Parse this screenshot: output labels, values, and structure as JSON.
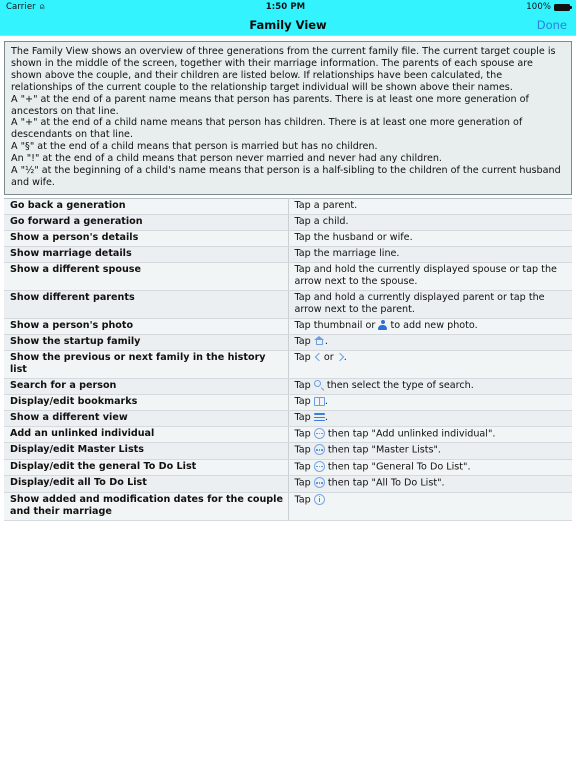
{
  "status_bar": {
    "carrier": "Carrier",
    "wifi_icon": "wifi-icon",
    "time": "1:50 PM",
    "battery_percent": "100%",
    "battery_icon": "battery-full-icon"
  },
  "nav_bar": {
    "title": "Family View",
    "done_label": "Done",
    "done_color": "#2a7fdc",
    "bar_color": "#33f3ff"
  },
  "info_box": {
    "paragraphs": [
      "The Family View shows an overview of three generations from the current family file. The current target couple is shown in the middle of the screen, together with their marriage information. The parents of each spouse are shown above the couple, and their children are listed below. If relationships have been calculated, the relationships of the current couple to the relationship target individual will be shown above their names.",
      "A \"+\" at the end of a parent name means that person has parents. There is at least one more generation of ancestors on that line.",
      "A \"+\" at the end of a child name means that person has children. There is at least one more generation of descendants on that line.",
      "A \"§\" at the end of a child means that person is married but has no children.",
      "An \"!\" at the end of a child means that person never married and never had any children.",
      "A \"½\" at the beginning of a child's name means that person is a half-sibling to the children of the current husband and wife."
    ]
  },
  "table": {
    "rows": [
      {
        "action": "Go back a generation",
        "howto_pre": "Tap a parent.",
        "icon": null,
        "howto_post": ""
      },
      {
        "action": "Go forward a generation",
        "howto_pre": "Tap a child.",
        "icon": null,
        "howto_post": ""
      },
      {
        "action": "Show a person's details",
        "howto_pre": "Tap the husband or wife.",
        "icon": null,
        "howto_post": ""
      },
      {
        "action": "Show marriage details",
        "howto_pre": "Tap the marriage line.",
        "icon": null,
        "howto_post": ""
      },
      {
        "action": "Show a different spouse",
        "howto_pre": "Tap and hold the currently displayed spouse or tap the arrow next to the spouse.",
        "icon": null,
        "howto_post": ""
      },
      {
        "action": "Show different parents",
        "howto_pre": "Tap and hold a currently displayed parent or tap the arrow next to the parent.",
        "icon": null,
        "howto_post": ""
      },
      {
        "action": "Show a person's photo",
        "howto_pre": "Tap thumbnail or",
        "icon": "person-icon",
        "howto_post": "to add new photo."
      },
      {
        "action": "Show the startup family",
        "howto_pre": "Tap",
        "icon": "home-icon",
        "howto_post": "."
      },
      {
        "action": "Show the previous or next family in the history list",
        "howto_pre": "Tap",
        "icon": "chevron-left-right-icon",
        "howto_post": ".",
        "icon_middle_text": "or"
      },
      {
        "action": "Search for a person",
        "howto_pre": "Tap",
        "icon": "search-icon",
        "howto_post": "then select the type of search."
      },
      {
        "action": "Display/edit bookmarks",
        "howto_pre": "Tap",
        "icon": "book-icon",
        "howto_post": "."
      },
      {
        "action": "Show a different view",
        "howto_pre": "Tap",
        "icon": "menu-icon",
        "howto_post": "."
      },
      {
        "action": "Add an unlinked individual",
        "howto_pre": "Tap",
        "icon": "more-icon",
        "howto_post": "then tap \"Add unlinked individual\"."
      },
      {
        "action": "Display/edit Master Lists",
        "howto_pre": "Tap",
        "icon": "more-icon",
        "howto_post": "then tap \"Master Lists\"."
      },
      {
        "action": "Display/edit the general To Do List",
        "howto_pre": "Tap",
        "icon": "more-icon",
        "howto_post": "then tap \"General To Do List\"."
      },
      {
        "action": "Display/edit all To Do List",
        "howto_pre": "Tap",
        "icon": "more-icon",
        "howto_post": "then tap \"All To Do List\"."
      },
      {
        "action": "Show added and modification dates for the couple and their marriage",
        "howto_pre": "Tap",
        "icon": "info-icon",
        "howto_post": ""
      }
    ]
  }
}
